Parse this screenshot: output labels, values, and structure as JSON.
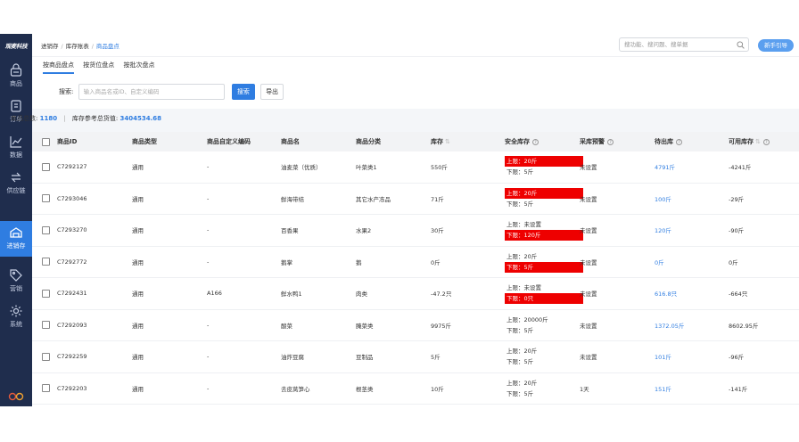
{
  "sidebar": {
    "logo": "观麦科技",
    "items": [
      {
        "label": "商品",
        "icon": "basket-icon"
      },
      {
        "label": "订单",
        "icon": "clipboard-icon"
      },
      {
        "label": "数据",
        "icon": "chart-icon"
      },
      {
        "label": "供应链",
        "icon": "transfer-icon"
      },
      {
        "label": "进销存",
        "icon": "warehouse-icon",
        "active": true
      },
      {
        "label": "营销",
        "icon": "tag-icon"
      },
      {
        "label": "系统",
        "icon": "gear-icon"
      }
    ]
  },
  "header": {
    "breadcrumb": [
      "进销存",
      "库存账表",
      "商品盘点"
    ],
    "search_placeholder": "搜功能、搜问题、搜单据",
    "guide_button": "新手引导"
  },
  "tabs": [
    "按商品盘点",
    "按货位盘点",
    "按批次盘点"
  ],
  "search": {
    "label": "搜索:",
    "placeholder": "输入商品名或ID、自定义编码",
    "search_button": "搜索",
    "export_button": "导出"
  },
  "summary": {
    "total_label": "商品总数:",
    "total_value": "1180",
    "ref_label": "库存参考总货值:",
    "ref_value": "3404534.68"
  },
  "table": {
    "headers": [
      "商品ID",
      "商品类型",
      "商品自定义编码",
      "商品名",
      "商品分类",
      "库存",
      "安全库存",
      "采库预警",
      "待出库",
      "可用库存"
    ],
    "rows": [
      {
        "id": "C7292127",
        "type": "通用",
        "code": "-",
        "name": "油麦菜（优质）",
        "category": "叶菜类1",
        "stock": "550斤",
        "upper": "上限：20斤",
        "lower": "下限：5斤",
        "warn": "upper",
        "alert": "未设置",
        "pending": "4791斤",
        "available": "-4241斤"
      },
      {
        "id": "C7293046",
        "type": "通用",
        "code": "-",
        "name": "鲜海带结",
        "category": "其它水产冻品",
        "stock": "71斤",
        "upper": "上限：20斤",
        "lower": "下限：5斤",
        "warn": "upper",
        "alert": "未设置",
        "pending": "100斤",
        "available": "-29斤"
      },
      {
        "id": "C7293270",
        "type": "通用",
        "code": "-",
        "name": "百香果",
        "category": "水果2",
        "stock": "30斤",
        "upper": "上限：未设置",
        "lower": "下限：120斤",
        "warn": "lower",
        "alert": "未设置",
        "pending": "120斤",
        "available": "-90斤"
      },
      {
        "id": "C7292772",
        "type": "通用",
        "code": "-",
        "name": "鹅掌",
        "category": "鹅",
        "stock": "0斤",
        "upper": "上限：20斤",
        "lower": "下限：5斤",
        "warn": "lower",
        "alert": "未设置",
        "pending": "0斤",
        "available": "0斤"
      },
      {
        "id": "C7292431",
        "type": "通用",
        "code": "A166",
        "name": "鲜水鸭1",
        "category": "肉类",
        "stock": "-47.2只",
        "upper": "上限：未设置",
        "lower": "下限：0只",
        "warn": "lower",
        "alert": "未设置",
        "pending": "616.8只",
        "available": "-664只"
      },
      {
        "id": "C7292093",
        "type": "通用",
        "code": "-",
        "name": "酸菜",
        "category": "腌菜类",
        "stock": "9975斤",
        "upper": "上限：20000斤",
        "lower": "下限：5斤",
        "warn": "none",
        "alert": "未设置",
        "pending": "1372.05斤",
        "available": "8602.95斤"
      },
      {
        "id": "C7292259",
        "type": "通用",
        "code": "-",
        "name": "油炸豆腐",
        "category": "豆制品",
        "stock": "5斤",
        "upper": "上限：20斤",
        "lower": "下限：5斤",
        "warn": "none",
        "alert": "未设置",
        "pending": "101斤",
        "available": "-96斤"
      },
      {
        "id": "C7292203",
        "type": "通用",
        "code": "-",
        "name": "去皮莴笋心",
        "category": "根茎类",
        "stock": "10斤",
        "upper": "上限：20斤",
        "lower": "下限：5斤",
        "warn": "none",
        "alert": "1天",
        "pending": "151斤",
        "available": "-141斤"
      }
    ]
  },
  "colors": {
    "accent": "#2f7de1",
    "sidebar": "#1f2d4d",
    "warning": "#ee0000"
  }
}
